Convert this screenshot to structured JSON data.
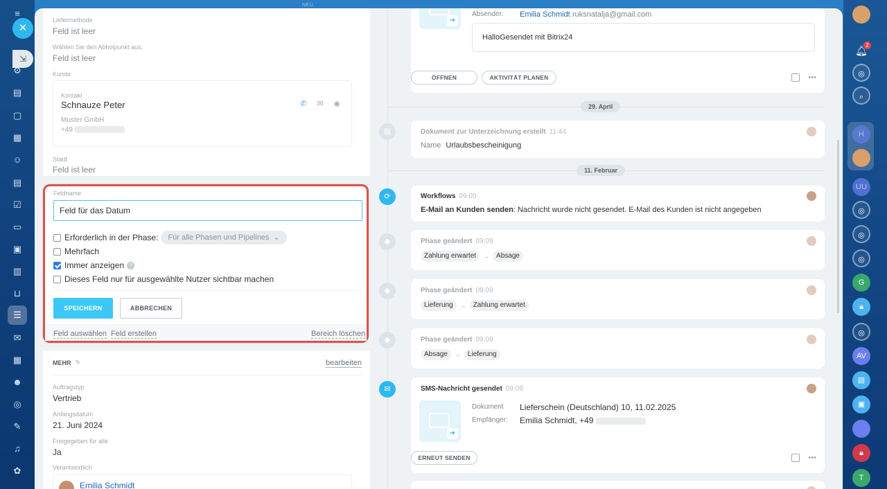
{
  "shell": {
    "top_ghost_label": "NEU",
    "close_icon": "close-icon",
    "notif_count": "2"
  },
  "left_rail_icons": [
    "menu-icon",
    "home-icon",
    "settings-icon",
    "document-icon",
    "chat-icon",
    "calendar-icon",
    "users-icon",
    "file-icon",
    "checkbox-icon",
    "card-icon",
    "monitor-icon",
    "chart-icon",
    "cart-icon",
    "filter-icon",
    "mail-icon",
    "grid-icon",
    "robot-icon",
    "target-icon",
    "sign-icon",
    "headset-icon",
    "gear-icon"
  ],
  "right_rail": {
    "items": [
      "H",
      "UU",
      "G",
      "AV",
      "T"
    ]
  },
  "fields": {
    "liefermethode_label": "Liefermethode",
    "liefermethode_value": "Feld ist leer",
    "abholpunkt_label": "Wählen Sie den Abholpunkt aus.",
    "abholpunkt_value": "Feld ist leer",
    "kunde_label": "Kunde",
    "stadt_label": "Stadt",
    "stadt_value": "Feld ist leer"
  },
  "contact": {
    "type_label": "Kontakt",
    "name": "Schnauze Peter",
    "company": "Muster GmbH",
    "phone_prefix": "+49"
  },
  "editor": {
    "field_label": "Feldname",
    "field_value": "Feld für das Datum",
    "required_label": "Erforderlich in der Phase:",
    "phase_select": "Für alle Phasen und Pipelines",
    "multiple_label": "Mehrfach",
    "always_show_label": "Immer anzeigen",
    "restricted_label": "Dieses Feld nur für ausgewählte Nutzer sichtbar machen",
    "save": "SPEICHERN",
    "cancel": "ABBRECHEN",
    "select_field": "Feld auswählen",
    "create_field": "Feld erstellen",
    "delete_section": "Bereich löschen",
    "checks": {
      "required": false,
      "multiple": false,
      "always_show": true,
      "restricted": false
    }
  },
  "mehr": {
    "title": "MEHR",
    "edit": "bearbeiten",
    "auftragstyp_label": "Auftragstyp",
    "auftragstyp_value": "Vertrieb",
    "anfangsdatum_label": "Anfangsdatum",
    "anfangsdatum_value": "21. Juni 2024",
    "freigegeben_label": "Freigegeben für alle",
    "freigegeben_value": "Ja",
    "verantwortlich_label": "Verantwortlich",
    "verantwortlich_name": "Emilia Schmidt"
  },
  "timeline": {
    "email": {
      "sender_label": "Absender:",
      "sender_name": "Emilia Schmidt",
      "sender_email": "ruksnatalja@gmail.com",
      "body": "HalloGesendet mit Bitrix24",
      "open": "ÖFFNEN",
      "plan": "AKTIVITÄT PLANEN"
    },
    "date1": "29. April",
    "doc": {
      "title": "Dokument zur Unterzeichnung erstellt",
      "time": "11:44",
      "name_label": "Name",
      "name_value": "Urlaubsbescheinigung"
    },
    "date2": "11. Februar",
    "workflow": {
      "title": "Workflows",
      "time": "09:09",
      "bold": "E-Mail an Kunden senden",
      "text": ": Nachricht wurde nicht gesendet. E-Mail des Kunden ist nicht angegeben"
    },
    "phases": [
      {
        "title": "Phase geändert",
        "time": "09:09",
        "from": "Zahlung erwartet",
        "to": "Absage"
      },
      {
        "title": "Phase geändert",
        "time": "09:09",
        "from": "Lieferung",
        "to": "Zahlung erwartet"
      },
      {
        "title": "Phase geändert",
        "time": "09:09",
        "from": "Absage",
        "to": "Lieferung"
      }
    ],
    "sms": {
      "title": "SMS-Nachricht gesendet",
      "time": "09:09",
      "doc_label": "Dokument",
      "doc_value": "Lieferschein (Deutschland) 10, 11.02.2025",
      "rcpt_label": "Empfänger:",
      "rcpt_value": "Emilia Schmidt, +49",
      "resend": "ERNEUT SENDEN"
    }
  }
}
